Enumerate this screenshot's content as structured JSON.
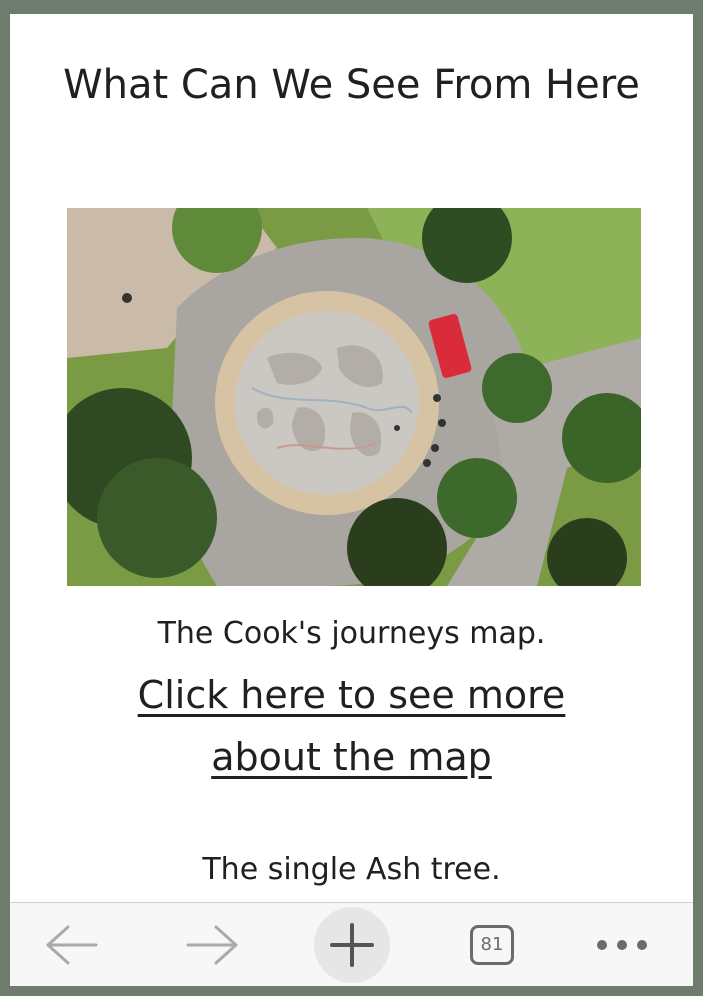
{
  "page": {
    "title": "What Can We See From Here"
  },
  "photo": {
    "subject": "aerial-view-compass-map-plaza"
  },
  "map_caption": "The Cook's journeys map.",
  "map_link": "Click here to see more about the map",
  "tree_caption": "The single Ash tree.",
  "toolbar": {
    "back_icon": "arrow-left-icon",
    "forward_icon": "arrow-right-icon",
    "new_tab_icon": "plus-icon",
    "tab_count": "81",
    "more_icon": "more-dots-icon"
  },
  "colors": {
    "frame": "#6e7c6e",
    "toolbar_icons": "#aaaaaa",
    "toolbar_tabs": "#6b6b6b"
  }
}
